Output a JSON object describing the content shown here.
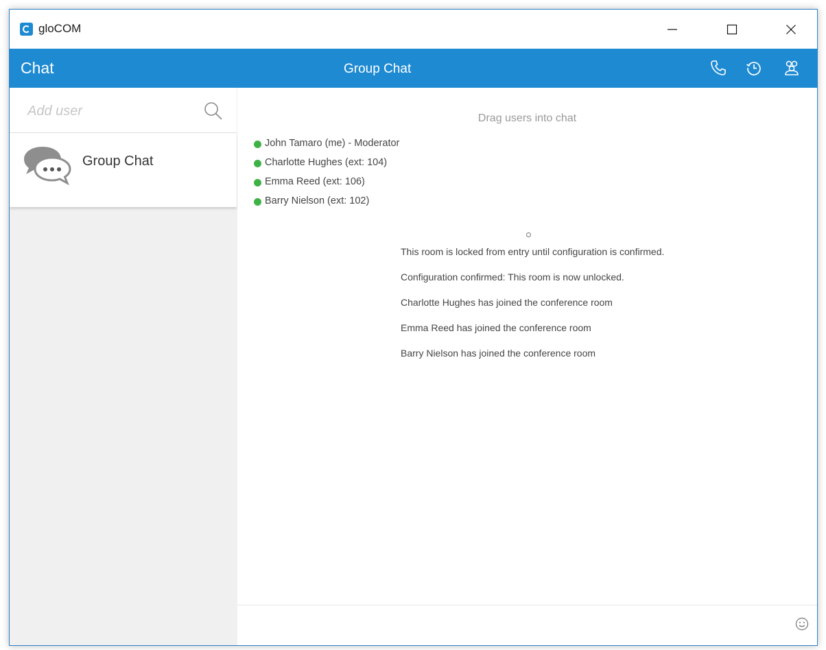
{
  "window": {
    "title": "gloCOM",
    "icons": [
      "app-logo",
      "minimize-icon",
      "maximize-icon",
      "close-icon"
    ]
  },
  "header": {
    "section_title": "Chat",
    "chat_title": "Group Chat",
    "icons": [
      "phone-icon",
      "history-icon",
      "participants-icon"
    ],
    "accent_color": "#1e8ad2"
  },
  "sidebar": {
    "search": {
      "placeholder": "Add user",
      "value": "",
      "icon": "search-icon"
    },
    "items": [
      {
        "label": "Group Chat",
        "icon": "chat-bubbles-icon"
      }
    ]
  },
  "main": {
    "drag_hint": "Drag users into chat",
    "participants": [
      {
        "name": "John Tamaro (me) - Moderator",
        "status": "online",
        "status_color": "#3fb246"
      },
      {
        "name": "Charlotte Hughes (ext: 104)",
        "status": "online",
        "status_color": "#3fb246"
      },
      {
        "name": "Emma Reed (ext: 106)",
        "status": "online",
        "status_color": "#3fb246"
      },
      {
        "name": "Barry Nielson (ext: 102)",
        "status": "online",
        "status_color": "#3fb246"
      }
    ],
    "messages": [
      "This room is locked from entry until configuration is confirmed.",
      "Configuration confirmed: This room is now unlocked.",
      "Charlotte Hughes has joined the conference room",
      "Emma Reed has joined the conference room",
      "Barry Nielson has joined the conference room"
    ],
    "composer": {
      "placeholder": "",
      "value": "",
      "icon": "emoji-icon"
    }
  }
}
